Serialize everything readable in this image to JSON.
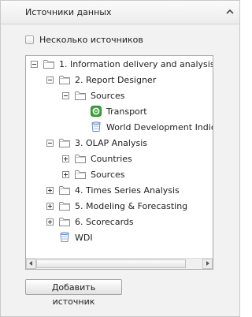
{
  "panel": {
    "title": "Источники данных",
    "multiple_sources_label": "Несколько источников",
    "multiple_sources_checked": false,
    "add_button_label": "Добавить источник"
  },
  "tree": {
    "nodes": [
      {
        "label": "1. Information delivery and analysis",
        "level": 0,
        "expander": "minus",
        "icon": "folder-icon"
      },
      {
        "label": "2. Report Designer",
        "level": 1,
        "expander": "minus",
        "icon": "folder-icon"
      },
      {
        "label": "Sources",
        "level": 2,
        "expander": "minus",
        "icon": "folder-icon"
      },
      {
        "label": "Transport",
        "level": 3,
        "expander": "none",
        "icon": "cube-source-icon"
      },
      {
        "label": "World Development Indicators",
        "level": 3,
        "expander": "none",
        "icon": "database-icon"
      },
      {
        "label": "3. OLAP Analysis",
        "level": 1,
        "expander": "minus",
        "icon": "folder-icon"
      },
      {
        "label": "Countries",
        "level": 2,
        "expander": "plus",
        "icon": "folder-icon"
      },
      {
        "label": "Sources",
        "level": 2,
        "expander": "plus",
        "icon": "folder-icon"
      },
      {
        "label": "4. Times Series Analysis",
        "level": 1,
        "expander": "plus",
        "icon": "folder-icon"
      },
      {
        "label": "5. Modeling & Forecasting",
        "level": 1,
        "expander": "plus",
        "icon": "folder-icon"
      },
      {
        "label": "6. Scorecards",
        "level": 1,
        "expander": "plus",
        "icon": "folder-icon"
      },
      {
        "label": "WDI",
        "level": 1,
        "expander": "none",
        "icon": "database-icon"
      }
    ]
  },
  "icons": {
    "collapse": "chevron-up-icon",
    "scroll_left": "arrow-left-icon",
    "scroll_right": "arrow-right-icon"
  },
  "colors": {
    "folder_fill": "#ffffff",
    "folder_stroke": "#8a8a8a",
    "cube_green": "#3ea33e",
    "database_blue": "#6b8fc9"
  }
}
